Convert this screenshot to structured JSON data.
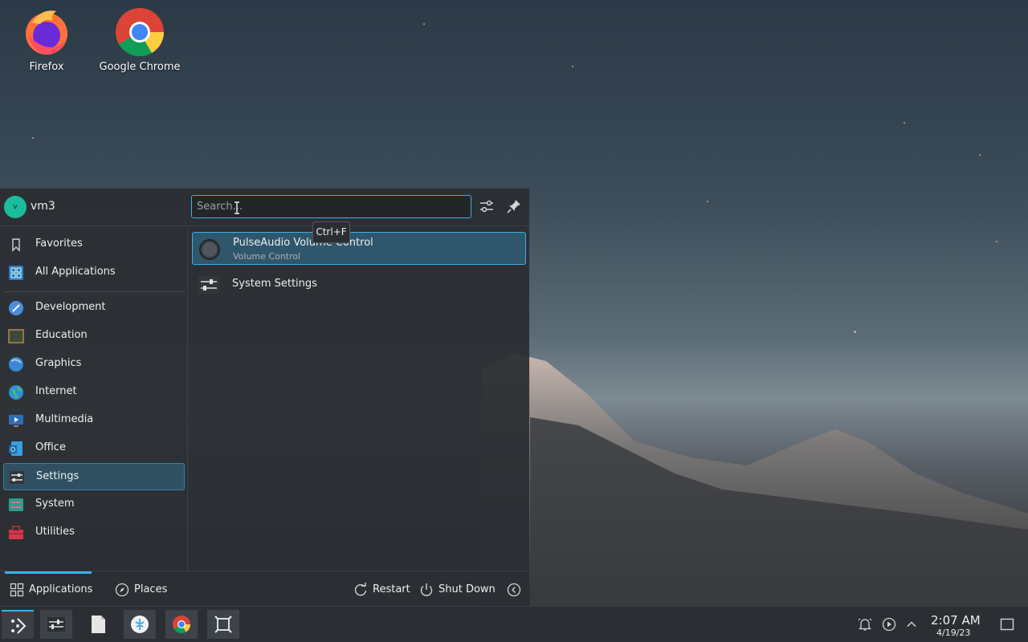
{
  "desktop": {
    "icons": [
      {
        "label": "Firefox"
      },
      {
        "label": "Google Chrome"
      }
    ]
  },
  "launcher": {
    "user": {
      "initial": "v",
      "name": "vm3"
    },
    "search": {
      "placeholder": "Search...",
      "value": ""
    },
    "tooltip": "Ctrl+F",
    "sidebar": [
      {
        "label": "Favorites",
        "icon": "bookmark-icon"
      },
      {
        "label": "All Applications",
        "icon": "grid-icon"
      },
      {
        "label": "Development",
        "icon": "development-icon"
      },
      {
        "label": "Education",
        "icon": "education-icon"
      },
      {
        "label": "Graphics",
        "icon": "graphics-icon"
      },
      {
        "label": "Internet",
        "icon": "globe-icon"
      },
      {
        "label": "Multimedia",
        "icon": "multimedia-icon"
      },
      {
        "label": "Office",
        "icon": "office-icon"
      },
      {
        "label": "Settings",
        "icon": "settings-icon",
        "active": true
      },
      {
        "label": "System",
        "icon": "system-icon"
      },
      {
        "label": "Utilities",
        "icon": "toolbox-icon"
      }
    ],
    "results": [
      {
        "title": "PulseAudio Volume Control",
        "subtitle": "Volume Control",
        "icon": "volume-knob-icon",
        "active": true
      },
      {
        "title": "System Settings",
        "subtitle": "",
        "icon": "system-settings-icon"
      }
    ],
    "footer": {
      "applications": "Applications",
      "places": "Places",
      "restart": "Restart",
      "shutdown": "Shut Down"
    }
  },
  "taskbar": {
    "clock": {
      "time": "2:07 AM",
      "date": "4/19/23"
    }
  },
  "colors": {
    "accent": "#3daee9",
    "panel": "#2a2e32",
    "taskbar": "#2b2f33"
  }
}
